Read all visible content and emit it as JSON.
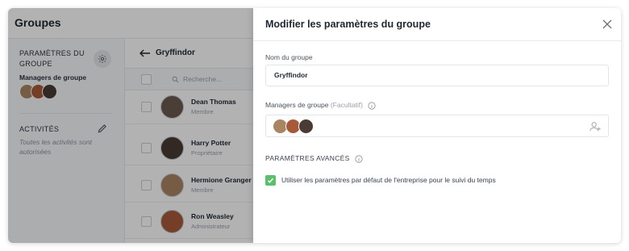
{
  "app": {
    "title": "Groupes"
  },
  "sidebar": {
    "settings_heading": "PARAMÈTRES DU GROUPE",
    "managers_label": "Managers de groupe",
    "activities_heading": "ACTIVITÉS",
    "activities_note": "Toutes les activités sont autorisées"
  },
  "main": {
    "group_name": "Gryffindor",
    "search_placeholder": "Recherche...",
    "members": [
      {
        "name": "Dean Thomas",
        "role": "Membre",
        "avatar_color": "#6b5a4e"
      },
      {
        "name": "Harry Potter",
        "role": "Propriétaire",
        "avatar_color": "#4a3c34"
      },
      {
        "name": "Hermione Granger",
        "role": "Membre",
        "avatar_color": "#a98563"
      },
      {
        "name": "Ron Weasley",
        "role": "Administrateur",
        "avatar_color": "#a65a3a"
      }
    ]
  },
  "drawer": {
    "title": "Modifier les paramètres du groupe",
    "group_name_label": "Nom du groupe",
    "group_name_value": "Gryffindor",
    "managers_label": "Managers de groupe",
    "managers_optional": "(Facultatif)",
    "managers": [
      {
        "avatar_color": "#a98563"
      },
      {
        "avatar_color": "#a65a3a"
      },
      {
        "avatar_color": "#4a3c34"
      }
    ],
    "advanced_label": "PARAMÈTRES AVANCÉS",
    "default_settings_label": "Utiliser les paramètres par défaut de l'entreprise pour le suivi du temps",
    "default_settings_checked": true
  },
  "colors": {
    "accent_green": "#5cbf6b",
    "overlay": "rgba(0,0,0,0.30)"
  },
  "icons": [
    "gear-icon",
    "pencil-icon",
    "back-arrow-icon",
    "search-icon",
    "close-icon",
    "info-icon",
    "add-user-icon",
    "check-icon"
  ]
}
